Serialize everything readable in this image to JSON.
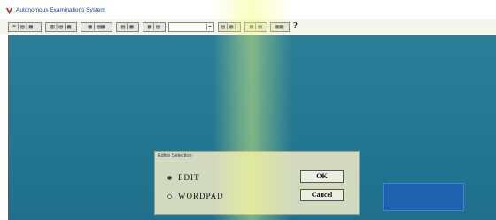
{
  "window": {
    "title": "Autonomous Examinations System",
    "icon": "app-logo-icon"
  },
  "toolbar": {
    "buttons": [
      {
        "label": "≡|▤|▦|",
        "icon": "toolbar-group-1-icons"
      },
      {
        "label": "▥|▤|▦",
        "icon": "toolbar-group-2-icons"
      },
      {
        "label": "▦|▤▦",
        "icon": "toolbar-group-3-icons"
      },
      {
        "label": "▤|▦",
        "icon": "toolbar-group-4-icons"
      },
      {
        "label": "▦|▤",
        "icon": "toolbar-group-5-icons"
      },
      {
        "label": "▤|▦|",
        "icon": "toolbar-group-6-icons"
      },
      {
        "label": "▦|▤",
        "icon": "toolbar-group-7-icons"
      },
      {
        "label": "▦▦",
        "icon": "toolbar-group-8-icons"
      }
    ],
    "combo_value": "",
    "help_glyph": "?"
  },
  "dialog": {
    "title": "Editor Selection",
    "options": [
      {
        "label": "EDIT",
        "selected": true
      },
      {
        "label": "WORDPAD",
        "selected": false
      }
    ],
    "ok_label": "OK",
    "cancel_label": "Cancel"
  },
  "colors": {
    "desktop": "#237792",
    "dialog_bg": "#d3d9bf",
    "accent_panel": "#1f63b0",
    "title_text": "#1a3a8a"
  }
}
